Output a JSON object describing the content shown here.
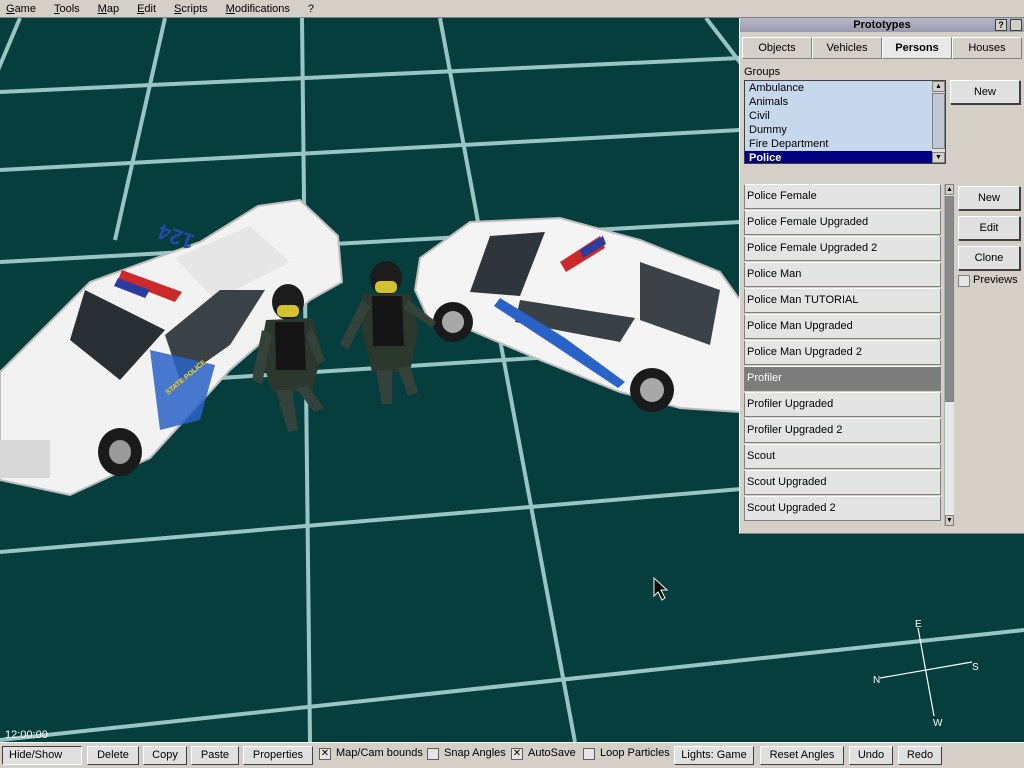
{
  "menu": [
    "Game",
    "Tools",
    "Map",
    "Edit",
    "Scripts",
    "Modifications",
    "?"
  ],
  "panel": {
    "title": "Prototypes",
    "help_label": "?",
    "tabs": [
      {
        "label": "Objects",
        "active": false
      },
      {
        "label": "Vehicles",
        "active": false
      },
      {
        "label": "Persons",
        "active": true
      },
      {
        "label": "Houses",
        "active": false
      }
    ],
    "groups_label": "Groups",
    "groups": [
      "Ambulance",
      "Animals",
      "Civil",
      "Dummy",
      "Fire Department",
      "Police"
    ],
    "groups_selected": "Police",
    "group_new_label": "New",
    "prototypes": [
      "Police Female",
      "Police Female Upgraded",
      "Police Female Upgraded 2",
      "Police Man",
      "Police Man TUTORIAL",
      "Police Man Upgraded",
      "Police Man Upgraded 2",
      "Profiler",
      "Profiler Upgraded",
      "Profiler Upgraded 2",
      "Scout",
      "Scout Upgraded",
      "Scout Upgraded 2"
    ],
    "prototype_selected": "Profiler",
    "buttons": {
      "new": "New",
      "edit": "Edit",
      "clone": "Clone"
    },
    "previews_label": "Previews"
  },
  "scene": {
    "car_left_number": "124",
    "car_left_badge": "STATE POLICE"
  },
  "compass": {
    "north": "N",
    "east": "E",
    "south": "S",
    "west": "W"
  },
  "clock": "12:00:00",
  "toolbar": {
    "hide_show": "Hide/Show",
    "delete": "Delete",
    "copy": "Copy",
    "paste": "Paste",
    "properties": "Properties",
    "map_cam_bounds": "Map/Cam bounds",
    "map_cam_bounds_checked": true,
    "snap_angles": "Snap Angles",
    "snap_angles_checked": false,
    "autosave": "AutoSave",
    "autosave_checked": true,
    "loop_particles": "Loop Particles",
    "loop_particles_checked": false,
    "lights": "Lights: Game",
    "reset_angles": "Reset Angles",
    "undo": "Undo",
    "redo": "Redo"
  },
  "colors": {
    "ground": "#063e3e",
    "grid": "#a8d4d2",
    "selected_group": "#000080",
    "selected_proto": "#7c7c7c"
  }
}
